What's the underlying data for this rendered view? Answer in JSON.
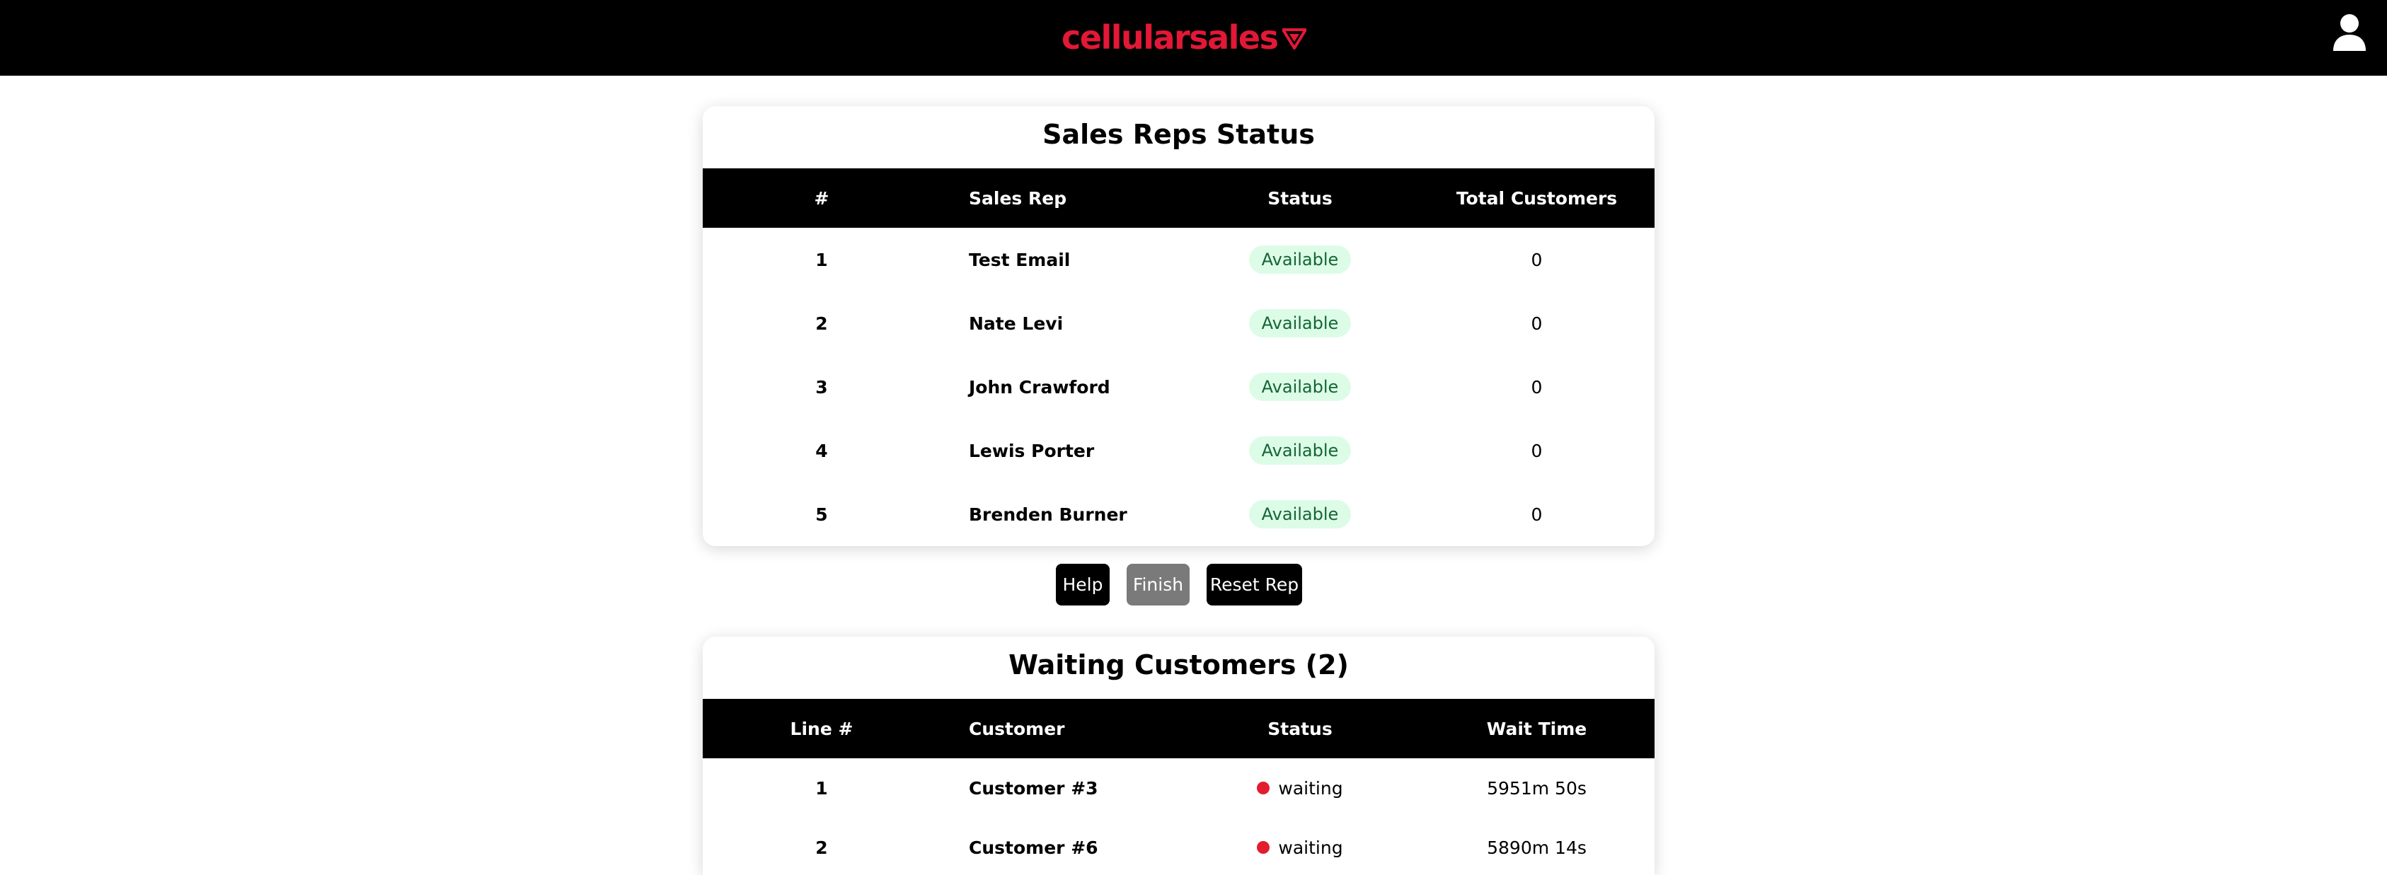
{
  "header": {
    "logo_text": "cellularsales",
    "brand_color": "#e31837",
    "user_icon": "user-icon"
  },
  "reps": {
    "title": "Sales Reps Status",
    "columns": [
      "#",
      "Sales Rep",
      "Status",
      "Total Customers"
    ],
    "rows": [
      {
        "num": "1",
        "name": "Test Email",
        "status": "Available",
        "total": "0"
      },
      {
        "num": "2",
        "name": "Nate Levi",
        "status": "Available",
        "total": "0"
      },
      {
        "num": "3",
        "name": "John Crawford",
        "status": "Available",
        "total": "0"
      },
      {
        "num": "4",
        "name": "Lewis Porter",
        "status": "Available",
        "total": "0"
      },
      {
        "num": "5",
        "name": "Brenden Burner",
        "status": "Available",
        "total": "0"
      }
    ]
  },
  "actions": {
    "help": "Help",
    "finish": "Finish",
    "reset": "Reset Rep"
  },
  "waiting": {
    "title": "Waiting Customers (2)",
    "columns": [
      "Line #",
      "Customer",
      "Status",
      "Wait Time"
    ],
    "rows": [
      {
        "line": "1",
        "customer": "Customer #3",
        "status": "waiting",
        "wait": "5951m 50s"
      },
      {
        "line": "2",
        "customer": "Customer #6",
        "status": "waiting",
        "wait": "5890m 14s"
      }
    ]
  },
  "colors": {
    "available_bg": "#dcfce7",
    "available_text": "#166534",
    "waiting_dot": "#e11d2e"
  }
}
